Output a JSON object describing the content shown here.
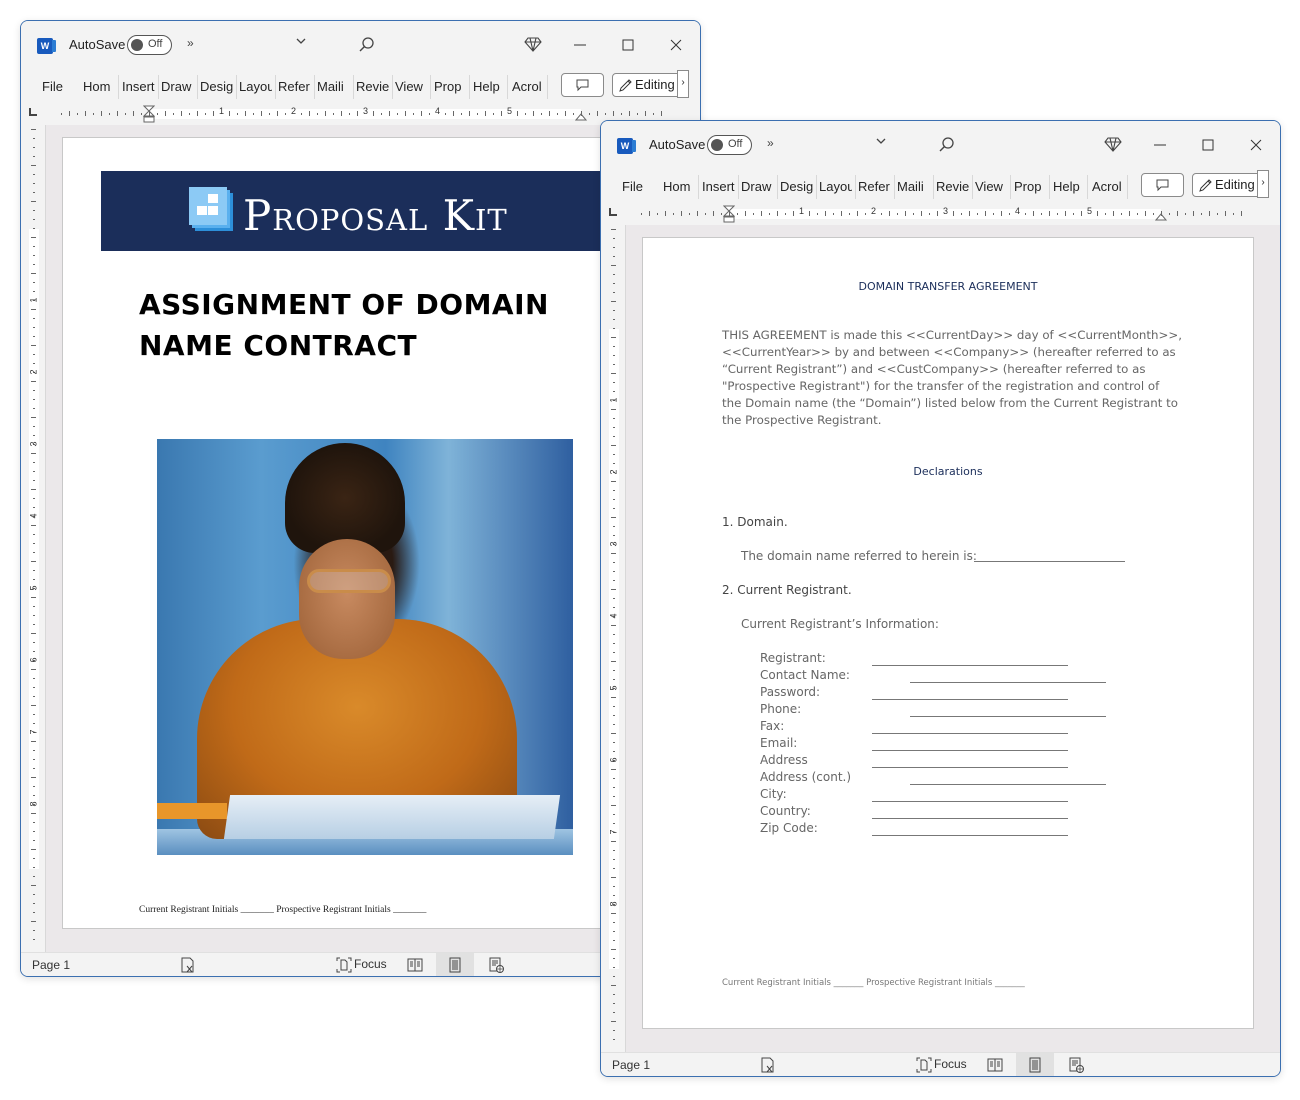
{
  "windows": [
    {
      "app_icon": "word-icon",
      "autosave_label": "AutoSave",
      "autosave_state": "Off",
      "more_commands": "»",
      "ribbon_tabs": [
        "File",
        "Home",
        "Insert",
        "Draw",
        "Design",
        "Layout",
        "References",
        "Mailings",
        "Review",
        "View",
        "Proposal",
        "Help",
        "Acrobat"
      ],
      "ribbon_tabs_visible": [
        "File",
        "Hom",
        "Insert",
        "Draw",
        "Desig",
        "Layou",
        "Refer",
        "Maili",
        "Revie",
        "View",
        "Prop",
        "Help",
        "Acrol"
      ],
      "editing_label": "Editing",
      "ruler_numbers": [
        "1",
        "2",
        "3",
        "4",
        "5"
      ],
      "vruler_numbers": [
        "1",
        "2",
        "3",
        "4",
        "5",
        "6",
        "7",
        "8"
      ],
      "status": {
        "page": "Page 1",
        "focus": "Focus"
      },
      "document": {
        "banner_brand": "Proposal Kit",
        "title_line1": "ASSIGNMENT OF DOMAIN",
        "title_line2": "NAME CONTRACT",
        "image_alt": "Painted illustration of a woman with glasses writing in a notebook",
        "footer": "Current Registrant Initials  _______ Prospective Registrant Initials _______"
      }
    },
    {
      "app_icon": "word-icon",
      "autosave_label": "AutoSave",
      "autosave_state": "Off",
      "more_commands": "»",
      "ribbon_tabs_visible": [
        "File",
        "Hom",
        "Insert",
        "Draw",
        "Desig",
        "Layou",
        "Refer",
        "Maili",
        "Revie",
        "View",
        "Prop",
        "Help",
        "Acrol"
      ],
      "editing_label": "Editing",
      "ruler_numbers": [
        "1",
        "2",
        "3",
        "4",
        "5"
      ],
      "vruler_numbers": [
        "1",
        "2",
        "3",
        "4",
        "5",
        "6",
        "7",
        "8"
      ],
      "status": {
        "page": "Page 1",
        "focus": "Focus"
      },
      "document": {
        "title": "DOMAIN TRANSFER AGREEMENT",
        "intro": "THIS AGREEMENT is made this <<CurrentDay>> day of <<CurrentMonth>>, <<CurrentYear>> by and between <<Company>> (hereafter referred to as “Current Registrant”) and <<CustCompany>> (hereafter referred to as \"Prospective Registrant\") for the transfer of the registration and control of the Domain name (the “Domain”) listed below from the Current Registrant to the Prospective Registrant.",
        "declarations": "Declarations",
        "section1": "1. Domain.",
        "section1_text": "The domain name referred to herein is:",
        "section2": "2. Current Registrant.",
        "section2_text": "Current Registrant’s Information:",
        "fields": [
          "Registrant:",
          "Contact Name:",
          "Password:",
          "Phone:",
          "Fax:",
          "Email:",
          "Address",
          "Address (cont.)",
          "City:",
          "Country:",
          "Zip Code:"
        ],
        "footer": "Current Registrant Initials _______ Prospective Registrant Initials _______"
      }
    }
  ],
  "colors": {
    "window_border": "#3b6fb0",
    "banner_bg": "#1b2e5a",
    "heading_navy": "#1b2e5a",
    "word_blue": "#185abd"
  }
}
